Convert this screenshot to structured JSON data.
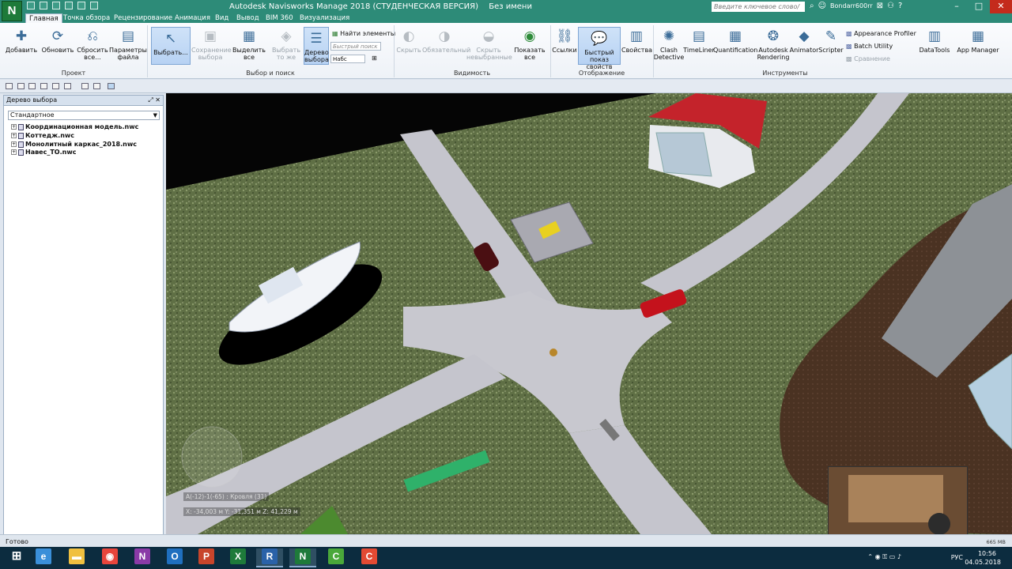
{
  "app": {
    "logo_letter": "N",
    "title": "Autodesk Navisworks Manage 2018 (СТУДЕНЧЕСКАЯ ВЕРСИЯ)",
    "document": "Без имени",
    "help_search_placeholder": "Введите ключевое слово/фразу",
    "user": "Bondarr600rr"
  },
  "ribbon_tabs": [
    "Главная",
    "Точка обзора",
    "Рецензирование",
    "Анимация",
    "Вид",
    "Вывод",
    "BIM 360",
    "Визуализация"
  ],
  "ribbon": {
    "project": {
      "label": "Проект",
      "add": "Добавить",
      "refresh": "Обновить",
      "reset": "Сбросить все...",
      "file_params": "Параметры файла"
    },
    "select": {
      "label": "Выбор и поиск",
      "select": "Выбрать...",
      "save_sel": "Сохранение выбора",
      "select_all": "Выделить все",
      "select_same": "Выбрать то же",
      "tree": "Дерево выбора",
      "find_items": "Найти элементы",
      "quick_find": "Быстрый поиск",
      "sets": "Набс"
    },
    "visibility": {
      "label": "Видимость",
      "hide": "Скрыть",
      "obligatory": "Обязательный",
      "hide_unselected": "Скрыть невыбранные",
      "show_all": "Показать все"
    },
    "display": {
      "label": "Отображение",
      "links": "Ссылки",
      "quick_props": "Быстрый показ свойств",
      "props": "Свойства"
    },
    "tools": {
      "label": "Инструменты",
      "clash": "Clash Detective",
      "timeliner": "TimeLiner",
      "quant": "Quantification",
      "autodesk_rendering": "Autodesk Rendering",
      "animator": "Animator",
      "scripter": "Scripter",
      "appearance_profiler": "Appearance Profiler",
      "batch_utility": "Batch Utility",
      "compare": "Сравнение",
      "datatools": "DataTools",
      "app_manager": "App Manager"
    }
  },
  "selection_tree": {
    "title": "Дерево выбора",
    "mode": "Стандартное",
    "items": [
      "Координационная модель.nwc",
      "Коттедж.nwc",
      "Монолитный каркас_2018.nwc",
      "Навес_ТО.nwc"
    ]
  },
  "viewport": {
    "grid_location": "A(-12)-1(-65) : Кровля (31)",
    "coords": "X: -34,003 м  Y: -31,351 м  Z: 41,229 м"
  },
  "status": {
    "text": "Готово",
    "memory": "665 MB"
  },
  "taskbar": {
    "apps": [
      {
        "name": "edge",
        "glyph": "e",
        "color": "#3a8fd9"
      },
      {
        "name": "explorer",
        "glyph": "▬",
        "color": "#f0c040"
      },
      {
        "name": "chrome",
        "glyph": "◉",
        "color": "#e8453c"
      },
      {
        "name": "onenote",
        "glyph": "N",
        "color": "#8a3aa7"
      },
      {
        "name": "outlook",
        "glyph": "O",
        "color": "#1f6fbf"
      },
      {
        "name": "powerpoint",
        "glyph": "P",
        "color": "#c8452b"
      },
      {
        "name": "excel",
        "glyph": "X",
        "color": "#1e7a3a"
      },
      {
        "name": "revit",
        "glyph": "R",
        "color": "#2a62a8"
      },
      {
        "name": "navisworks",
        "glyph": "N",
        "color": "#1e7a3a"
      },
      {
        "name": "camtasia",
        "glyph": "C",
        "color": "#4aa83a"
      },
      {
        "name": "screencast",
        "glyph": "C",
        "color": "#e34a33"
      }
    ],
    "lang": "РУС",
    "time": "10:56",
    "date": "04.05.2018"
  }
}
